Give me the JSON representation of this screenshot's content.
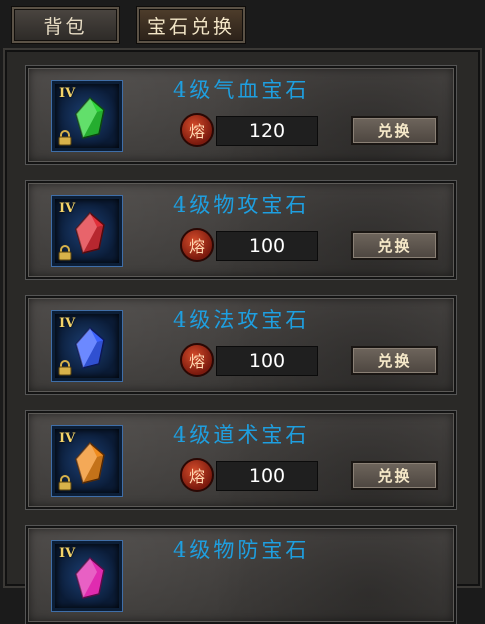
{
  "tabs": [
    {
      "label": "背包"
    },
    {
      "label": "宝石兑换"
    }
  ],
  "currency_glyph": "熔",
  "exchange_label": "兑换",
  "items": [
    {
      "tier": "IV",
      "name": "4级气血宝石",
      "cost": "120",
      "gem_color": "#2ed43a",
      "gem_icon": "green-gem-icon"
    },
    {
      "tier": "IV",
      "name": "4级物攻宝石",
      "cost": "100",
      "gem_color": "#e0303a",
      "gem_icon": "red-gem-icon"
    },
    {
      "tier": "IV",
      "name": "4级法攻宝石",
      "cost": "100",
      "gem_color": "#3b62ff",
      "gem_icon": "blue-gem-icon"
    },
    {
      "tier": "IV",
      "name": "4级道术宝石",
      "cost": "100",
      "gem_color": "#f08c1f",
      "gem_icon": "orange-gem-icon"
    },
    {
      "tier": "IV",
      "name": "4级物防宝石",
      "cost": "",
      "gem_color": "#e02bb0",
      "gem_icon": "pink-gem-icon"
    }
  ]
}
